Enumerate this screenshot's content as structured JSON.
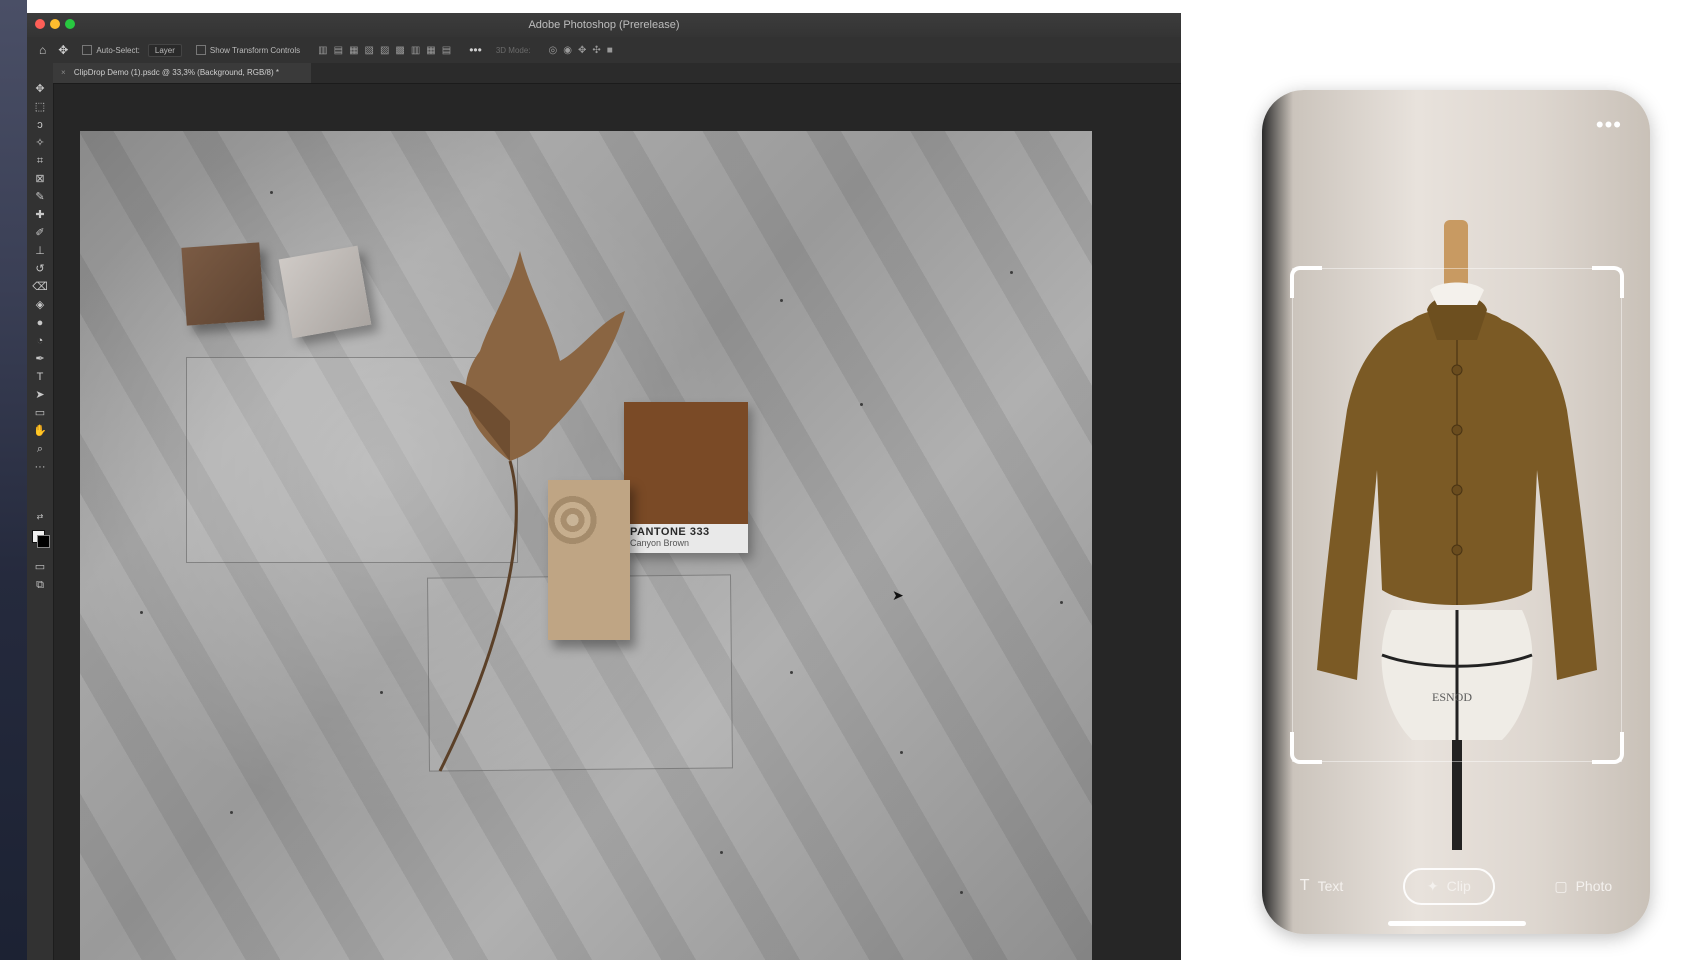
{
  "window": {
    "title": "Adobe Photoshop (Prerelease)",
    "document_tab": "ClipDrop Demo (1).psdc @ 33,3% (Background, RGB/8) *"
  },
  "options_bar": {
    "auto_select_label": "Auto-Select:",
    "layer_select_value": "Layer",
    "transform_label": "Show Transform Controls",
    "mode_3d_label": "3D Mode:"
  },
  "canvas": {
    "pantone_name": "PANTONE 333",
    "pantone_subtitle": "Canyon Brown",
    "pantone_color": "#7a4a26"
  },
  "phone": {
    "nav": [
      {
        "label": "Text",
        "icon": "text-icon"
      },
      {
        "label": "Clip",
        "icon": "magic-wand-icon"
      },
      {
        "label": "Photo",
        "icon": "photo-icon"
      }
    ],
    "mannequin_brand": "ESNOD",
    "more_icon": "more-dots-icon"
  },
  "tools": [
    "move-tool-icon",
    "marquee-tool-icon",
    "lasso-tool-icon",
    "magic-wand-tool-icon",
    "crop-tool-icon",
    "frame-tool-icon",
    "eyedropper-tool-icon",
    "healing-tool-icon",
    "brush-tool-icon",
    "stamp-tool-icon",
    "history-brush-tool-icon",
    "eraser-tool-icon",
    "bucket-tool-icon",
    "blur-tool-icon",
    "dodge-tool-icon",
    "pen-tool-icon",
    "type-tool-icon",
    "path-select-tool-icon",
    "shape-tool-icon",
    "hand-tool-icon",
    "zoom-tool-icon",
    "more-tools-icon"
  ]
}
